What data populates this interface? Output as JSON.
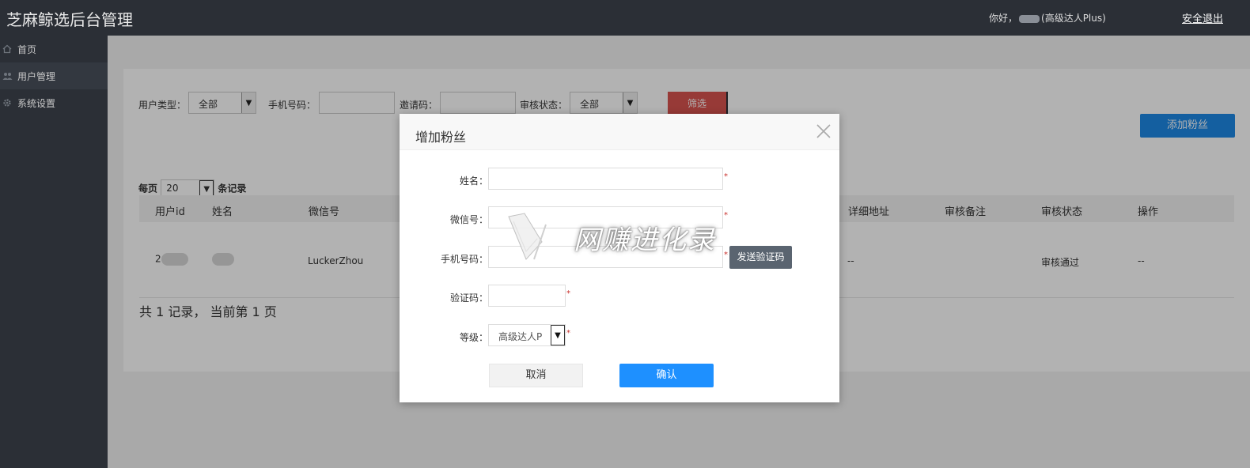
{
  "header": {
    "app_title": "芝麻鲸选后台管理",
    "greeting_prefix": "你好，",
    "greeting_suffix": "(高级达人Plus)",
    "logout": "安全退出"
  },
  "sidebar": {
    "items": [
      {
        "label": "首页",
        "icon": "home-icon"
      },
      {
        "label": "用户管理",
        "icon": "users-icon",
        "active": true
      },
      {
        "label": "系统设置",
        "icon": "gear-icon"
      }
    ]
  },
  "filters": {
    "user_type_label": "用户类型：",
    "user_type_value": "全部",
    "phone_label": "手机号码：",
    "invite_label": "邀请码：",
    "status_label": "审核状态：",
    "status_value": "全部",
    "filter_button": "筛选"
  },
  "add_button": "添加粉丝",
  "paging": {
    "prefix": "每页",
    "value": "20",
    "suffix": "条记录",
    "summary": "共 1 记录， 当前第 1 页"
  },
  "table": {
    "columns": [
      "用户id",
      "姓名",
      "微信号",
      "详细地址",
      "审核备注",
      "审核状态",
      "操作"
    ],
    "rows": [
      {
        "id": "2",
        "wechat": "LuckerZhou",
        "address": "--",
        "remark": "",
        "status": "审核通过",
        "action": "--"
      }
    ]
  },
  "modal": {
    "title": "增加粉丝",
    "name_label": "姓名：",
    "wechat_label": "微信号：",
    "phone_label": "手机号码：",
    "sms_button": "发送验证码",
    "code_label": "验证码：",
    "level_label": "等级：",
    "level_value": "高级达人P",
    "required_mark": "*",
    "cancel_button": "取消",
    "confirm_button": "确认",
    "watermark": "网赚进化录"
  },
  "colors": {
    "topbar": "#2b2f36",
    "filter_button": "#d9534f",
    "primary": "#1e88e5",
    "sms_button": "#5a6470"
  }
}
